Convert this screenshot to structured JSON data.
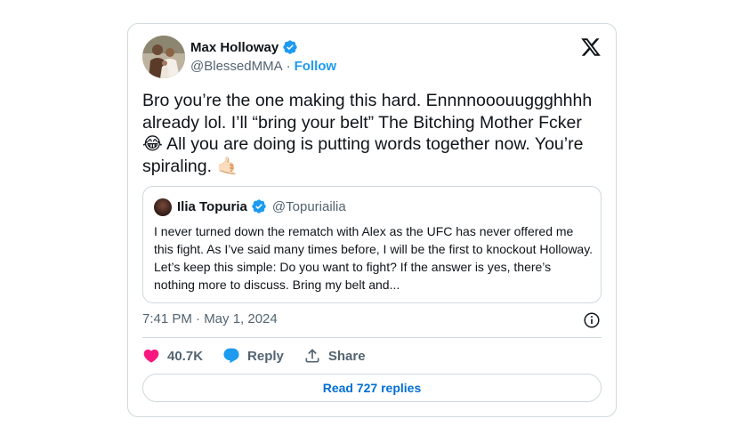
{
  "author": {
    "name": "Max Holloway",
    "handle": "@BlessedMMA",
    "separator": "·",
    "follow_label": "Follow"
  },
  "tweet": {
    "text": "Bro you’re the one making this hard. Ennnnooouuggghhhh already lol. I’ll “bring your belt” The Bitching Mother Fcker 😂 All you are doing is putting words together now. You’re spiraling. 🤙🏻"
  },
  "quoted": {
    "name": "Ilia Topuria",
    "handle": "@Topuriailia",
    "text": "I never turned down the rematch with Alex as the UFC has never offered me this fight. As I’ve said many times before, I will be the first to knockout Holloway. Let’s keep this simple: Do you want to fight? If the answer is yes, there’s nothing more to discuss. Bring my belt and..."
  },
  "meta": {
    "timestamp": "7:41 PM · May 1, 2024"
  },
  "actions": {
    "likes": "40.7K",
    "reply_label": "Reply",
    "share_label": "Share"
  },
  "read_replies_label": "Read 727 replies",
  "icons": {
    "logo": "x-logo-icon",
    "verified": "verified-badge-icon",
    "info": "info-icon",
    "like": "heart-icon",
    "reply": "speech-bubble-icon",
    "share": "share-upload-icon"
  },
  "colors": {
    "accent": "#1d9bf0",
    "like": "#f91880",
    "muted": "#536471",
    "border": "#cfd9de",
    "read_link": "#006fd6"
  }
}
